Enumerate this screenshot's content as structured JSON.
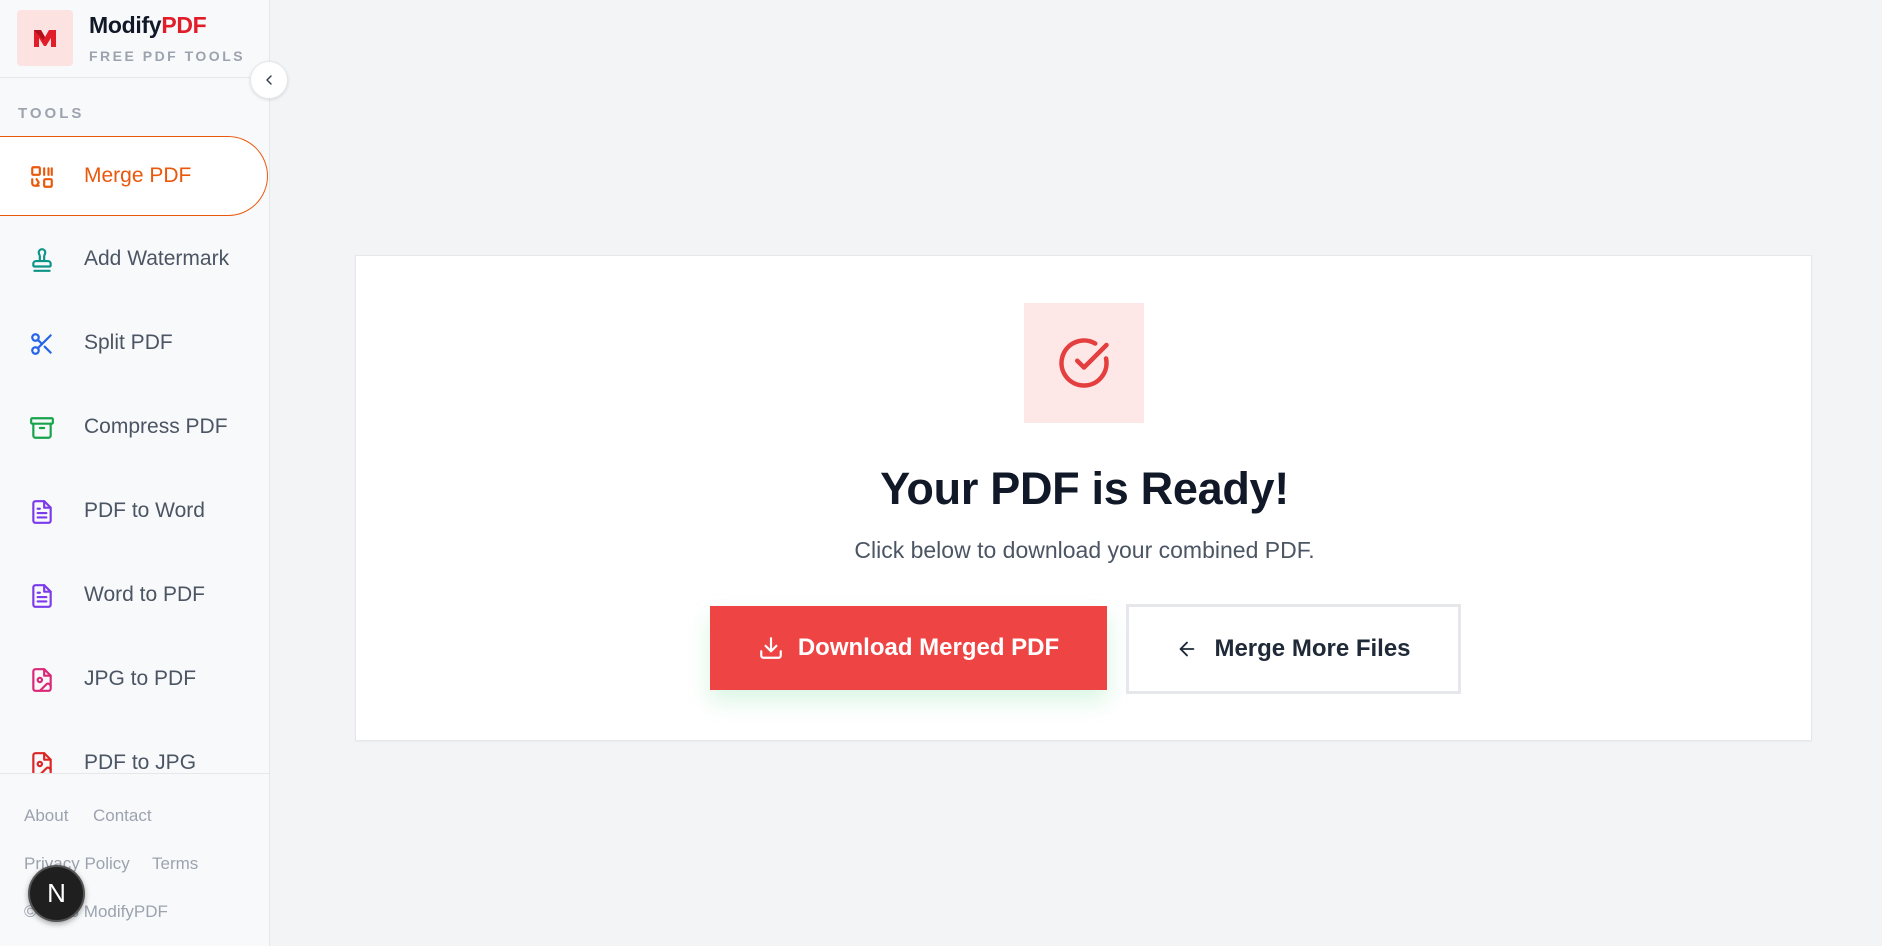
{
  "brand": {
    "name_main": "Modify",
    "name_accent": "PDF",
    "tagline": "FREE PDF TOOLS"
  },
  "sidebar": {
    "section_label": "TOOLS",
    "items": [
      {
        "label": "Merge PDF",
        "icon": "merge-icon",
        "color": "#ea580c",
        "active": true
      },
      {
        "label": "Add Watermark",
        "icon": "stamp-icon",
        "color": "#0d9488",
        "active": false
      },
      {
        "label": "Split PDF",
        "icon": "scissors-icon",
        "color": "#2563eb",
        "active": false
      },
      {
        "label": "Compress PDF",
        "icon": "archive-icon",
        "color": "#16a34a",
        "active": false
      },
      {
        "label": "PDF to Word",
        "icon": "document-icon",
        "color": "#7c3aed",
        "active": false
      },
      {
        "label": "Word to PDF",
        "icon": "document-icon",
        "color": "#7c3aed",
        "active": false
      },
      {
        "label": "JPG to PDF",
        "icon": "image-file-icon",
        "color": "#db2777",
        "active": false
      },
      {
        "label": "PDF to JPG",
        "icon": "image-file-icon",
        "color": "#dc2626",
        "active": false
      }
    ]
  },
  "footer": {
    "links": [
      "About",
      "Contact",
      "Privacy Policy",
      "Terms"
    ],
    "copyright": "© 2025 ModifyPDF"
  },
  "dev_badge": "N",
  "result": {
    "title": "Your PDF is Ready!",
    "subtitle": "Click below to download your combined PDF.",
    "download_label": "Download Merged PDF",
    "more_label": "Merge More Files"
  },
  "colors": {
    "accent_red": "#ef4444",
    "active_orange": "#ea580c",
    "brand_red": "#e11d2a"
  }
}
